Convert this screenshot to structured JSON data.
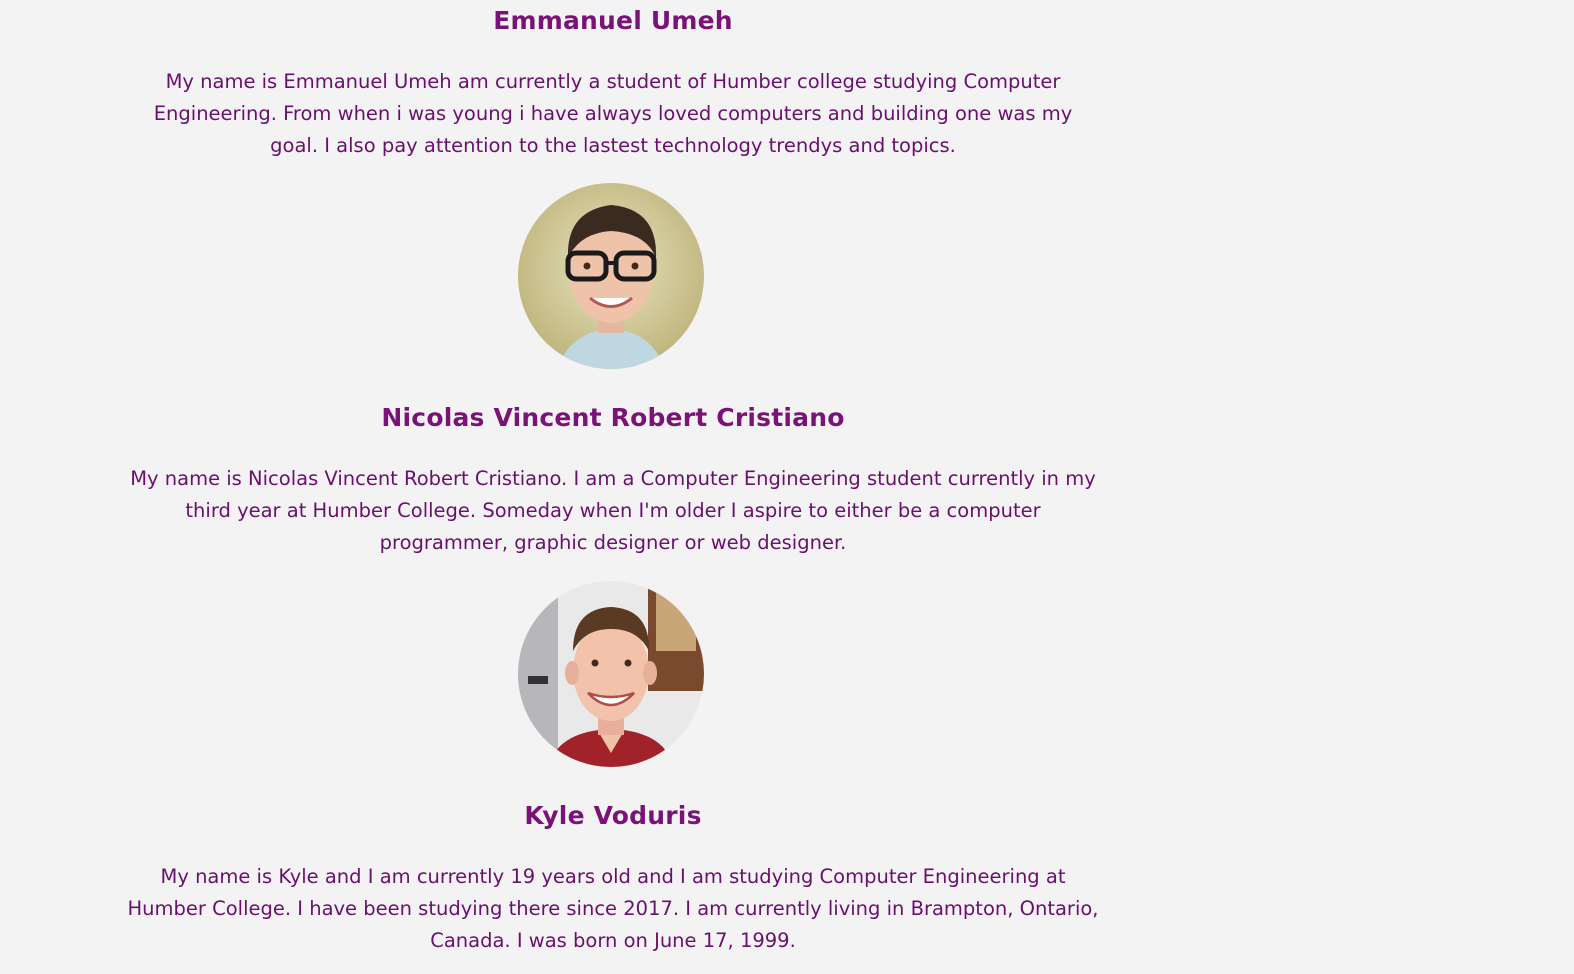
{
  "members": [
    {
      "name": "Emmanuel Umeh",
      "bio": "My name is Emmanuel Umeh am currently a student of Humber college studying Computer Engineering. From when i was young i have always loved computers and building one was my goal. I also pay attention to the lastest technology trendys and topics."
    },
    {
      "name": "Nicolas Vincent Robert Cristiano",
      "bio": "My name is Nicolas Vincent Robert Cristiano. I am a Computer Engineering student currently in my third year at Humber College. Someday when I'm older I aspire to either be a computer programmer, graphic designer or web designer."
    },
    {
      "name": "Kyle Voduris",
      "bio": "My name is Kyle and I am currently 19 years old and I am studying Computer Engineering at Humber College. I have been studying there since 2017. I am currently living in Brampton, Ontario, Canada. I was born on June 17, 1999."
    }
  ],
  "colors": {
    "background": "#f3f3f3",
    "heading": "#7a1277",
    "text": "#6b0f6e"
  }
}
